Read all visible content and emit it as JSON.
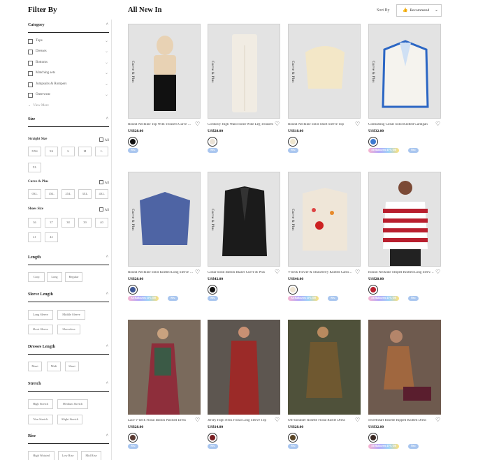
{
  "sidebar": {
    "title": "Filter By",
    "category": {
      "label": "Category",
      "items": [
        "Tops",
        "Dresses",
        "Bottoms",
        "Matching sets",
        "Jumpsuits & Rompers",
        "Outerwear"
      ],
      "view_more": "View More"
    },
    "size": {
      "label": "Size",
      "straight_label": "Straight Size",
      "straight": [
        "XXS",
        "XS",
        "S",
        "M",
        "L",
        "XL"
      ],
      "curve_label": "Curve & Plus",
      "curve": [
        "0XL",
        "1XL",
        "2XL",
        "3XL",
        "4XL"
      ],
      "shoes_label": "Shoes Size",
      "shoes": [
        "36",
        "37",
        "38",
        "39",
        "40",
        "41",
        "42"
      ],
      "all_label": "All"
    },
    "length": {
      "label": "Length",
      "options": [
        "Crop",
        "Long",
        "Regular"
      ]
    },
    "sleeve_length": {
      "label": "Sleeve Length",
      "options": [
        "Long Sleeve",
        "Middle Sleeve",
        "Short Sleeve",
        "Sleeveless"
      ]
    },
    "dresses_length": {
      "label": "Dresses Length",
      "options": [
        "Maxi",
        "Midi",
        "Short"
      ]
    },
    "stretch": {
      "label": "Stretch",
      "options": [
        "High Stretch",
        "Medium Stretch",
        "Non Stretch",
        "Slight Stretch"
      ]
    },
    "rise": {
      "label": "Rise",
      "options": [
        "High Waisted",
        "Low Rise",
        "Mid Rise"
      ]
    }
  },
  "main": {
    "title": "All New In",
    "sort_label": "Sort By",
    "sort_value": "Recommend",
    "badge_text": "Curve & Plus",
    "tag_sale": "All Halloween 15% Off",
    "tag_new": "New",
    "products": [
      {
        "name": "Round Neckline Top With Trousers Curve & Plus",
        "price": "US$28.00",
        "swatch": "#111111"
      },
      {
        "name": "Corduroy High Waist Solid Wide Leg Trousers",
        "price": "US$28.00",
        "swatch": "#eae2d6"
      },
      {
        "name": "Round Neckline Solid Short Sleeve Top",
        "price": "US$18.00",
        "swatch": "#efe6cf"
      },
      {
        "name": "Contrasting Collar Solid Knitted Cardigan",
        "price": "US$32.00",
        "swatch": "#3d7bd1"
      },
      {
        "name": "Round Neckline Solid Knitted Long Sleeve Sweater",
        "price": "US$28.00",
        "swatch": "#3f5796"
      },
      {
        "name": "Collar Solid Button Blazer Curve & Plus",
        "price": "US$42.00",
        "swatch": "#111111"
      },
      {
        "name": "V-neck Flower & Strawberry Knitted Cardigan",
        "price": "US$40.00",
        "swatch": "#eee4d2"
      },
      {
        "name": "Round Neckline Striped Knitted Long Sleeve Sweater",
        "price": "US$28.00",
        "swatch": "#b81f2e"
      },
      {
        "name": "Lace V-neck Floral Button Patched Dress",
        "price": "US$28.00",
        "swatch": "#5a3a32"
      },
      {
        "name": "Jersey High Neck Floral Long Sleeve Top",
        "price": "US$14.00",
        "swatch": "#7a1f22"
      },
      {
        "name": "Off-shoulder Rosette Floral Ruffle Dress",
        "price": "US$28.00",
        "swatch": "#5a4526"
      },
      {
        "name": "Sweetheart Rosette Ripped Knitted Dress",
        "price": "US$32.00",
        "swatch": "#3b2a25"
      }
    ]
  }
}
